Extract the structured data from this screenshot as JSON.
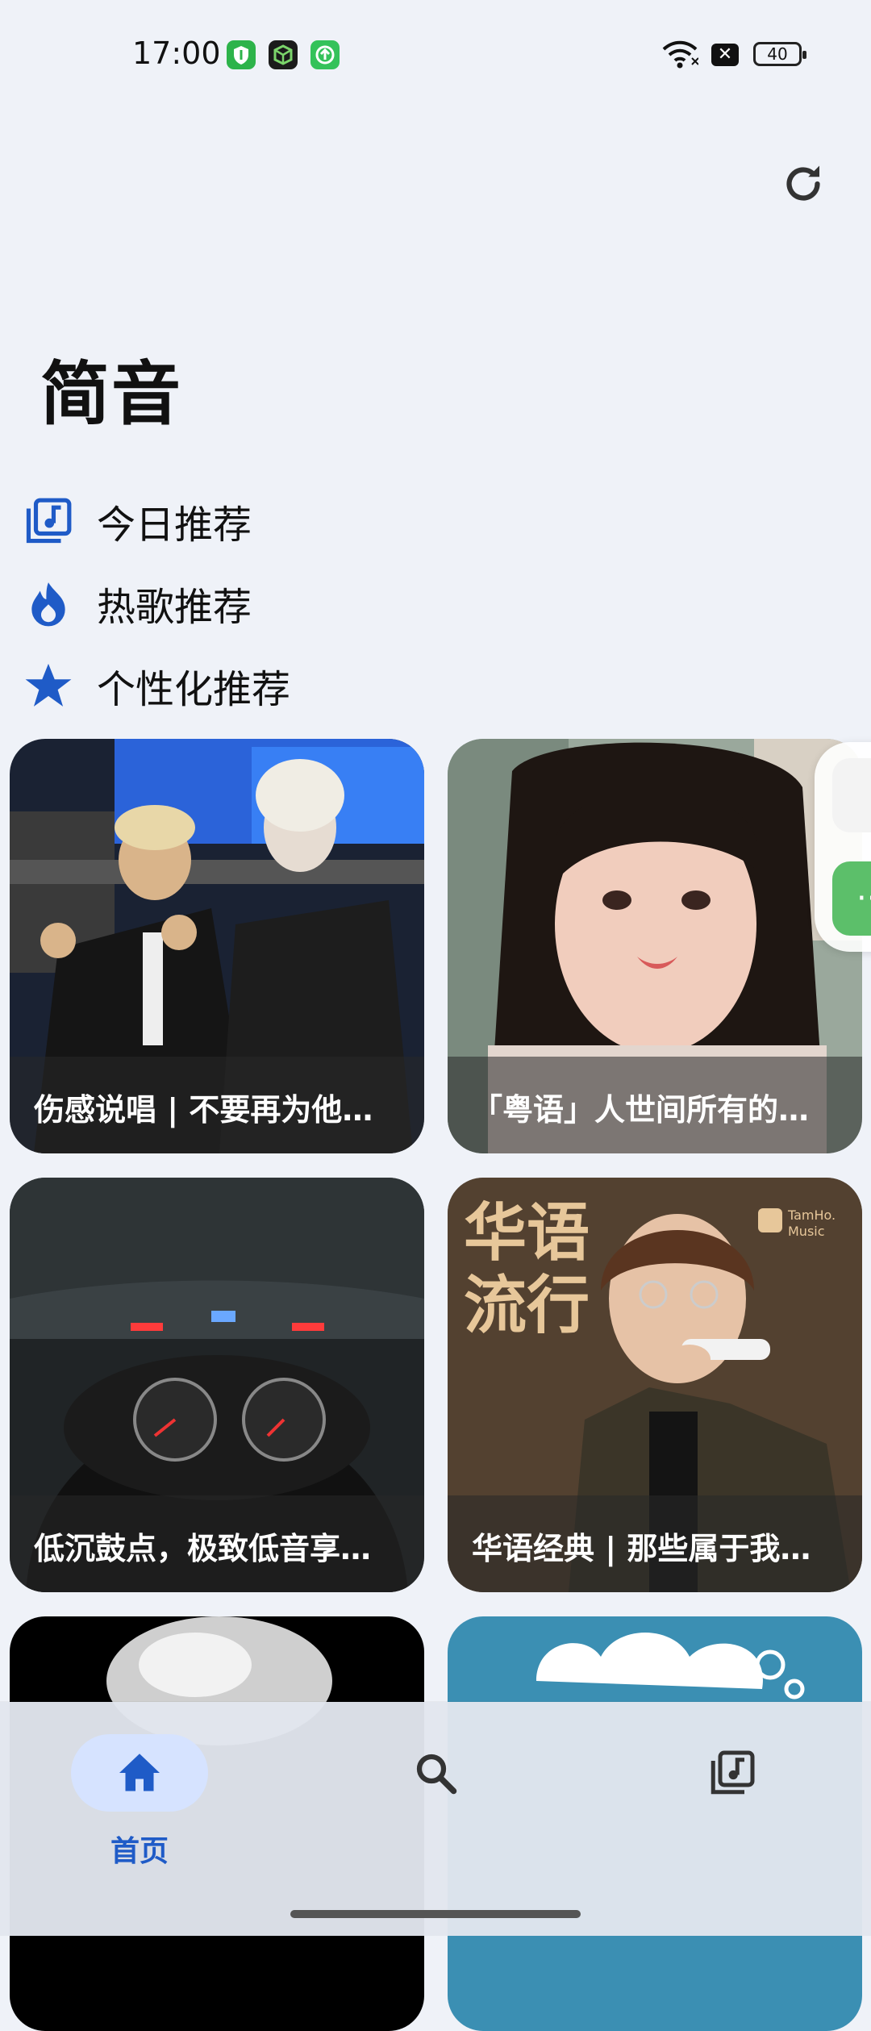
{
  "status_bar": {
    "time": "17:00",
    "battery": "40",
    "icons": [
      "shield-app-icon",
      "box-app-icon",
      "upload-app-icon",
      "wifi-icon",
      "no-sim-icon",
      "battery-icon"
    ]
  },
  "app": {
    "title": "简音",
    "accent_color": "#1f5bc7"
  },
  "menu": {
    "items": [
      {
        "label": "今日推荐",
        "icon": "music-library-icon"
      },
      {
        "label": "热歌推荐",
        "icon": "flame-icon"
      },
      {
        "label": "个性化推荐",
        "icon": "star-icon"
      }
    ]
  },
  "playlists": [
    {
      "caption": "伤感说唱 | 不要再为他…"
    },
    {
      "caption": "「粤语」人世间所有的…"
    },
    {
      "caption": "低沉鼓点，极致低音享…"
    },
    {
      "caption": "华语经典 | 那些属于我…"
    },
    {
      "caption": ""
    },
    {
      "caption": ""
    }
  ],
  "cover_text": {
    "mandopop_title_1": "华语",
    "mandopop_title_2": "流行",
    "mandopop_brand": "TamHo.\nMusic"
  },
  "bottom_nav": {
    "items": [
      {
        "label": "首页",
        "icon": "home-icon",
        "active": true
      },
      {
        "label": "",
        "icon": "search-icon",
        "active": false
      },
      {
        "label": "",
        "icon": "music-library-icon",
        "active": false
      }
    ]
  }
}
